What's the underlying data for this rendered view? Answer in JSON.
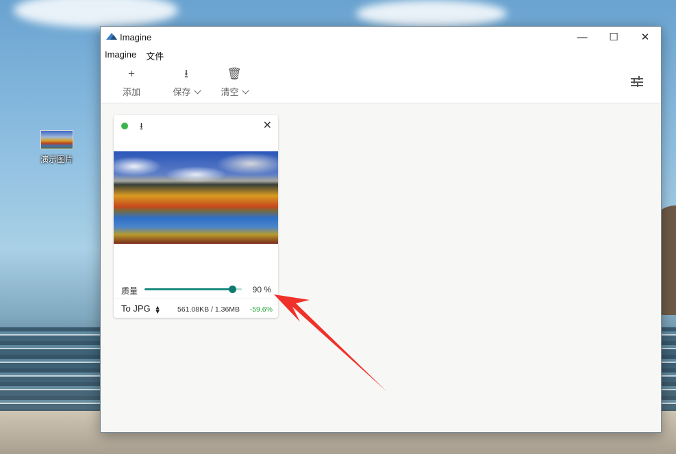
{
  "desktop": {
    "icon_label": "演示图片"
  },
  "window": {
    "title": "Imagine",
    "controls": {
      "minimize": "—",
      "maximize": "☐",
      "close": "✕"
    }
  },
  "menu": [
    "Imagine",
    "文件"
  ],
  "toolbar": {
    "add_label": "添加",
    "save_label": "保存",
    "clear_label": "清空"
  },
  "card": {
    "status_color": "#3cb44b",
    "quality_label": "质量",
    "quality_value": "90 %",
    "quality_percent": 90,
    "format": "To JPG",
    "size_text": "561.08KB / 1.36MB",
    "reduction": "-59.6%"
  },
  "colors": {
    "accent": "#1a8a80",
    "annotation_arrow": "#f0312a"
  }
}
